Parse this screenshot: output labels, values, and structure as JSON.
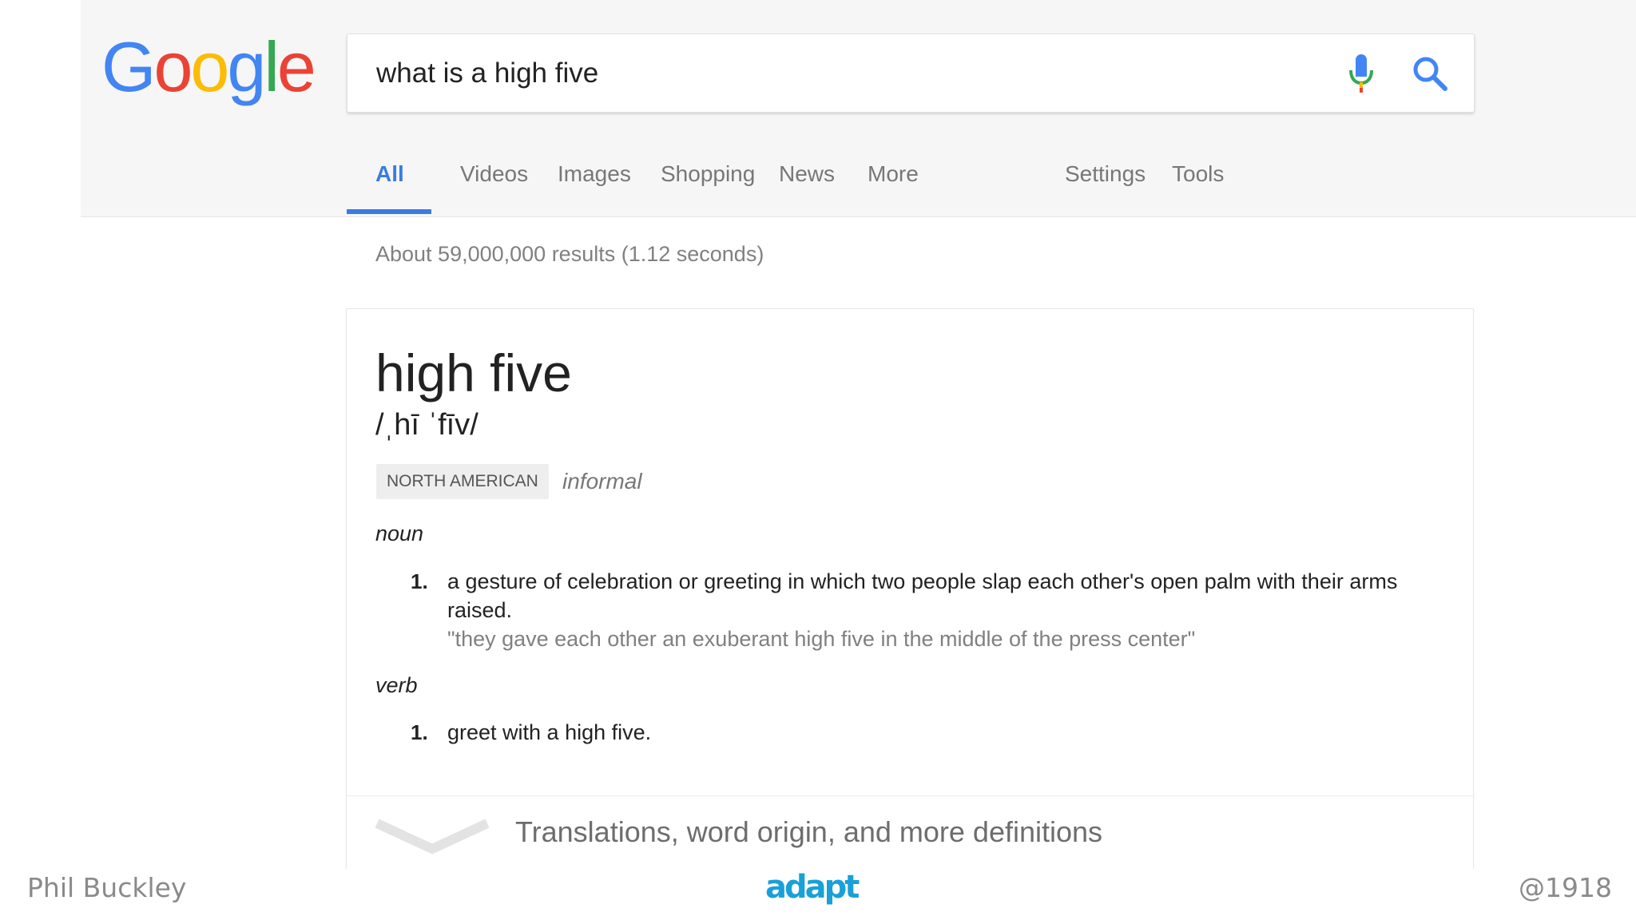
{
  "logo": {
    "letters": [
      "G",
      "o",
      "o",
      "g",
      "l",
      "e"
    ],
    "colors": [
      "#4285f4",
      "#ea4335",
      "#fbbc05",
      "#4285f4",
      "#34a853",
      "#ea4335"
    ]
  },
  "search": {
    "query": "what is a high five",
    "mic_icon": "mic-icon",
    "search_icon": "search-icon"
  },
  "tabs": [
    {
      "label": "All",
      "active": true
    },
    {
      "label": "Videos",
      "active": false
    },
    {
      "label": "Images",
      "active": false
    },
    {
      "label": "Shopping",
      "active": false
    },
    {
      "label": "News",
      "active": false
    },
    {
      "label": "More",
      "active": false
    },
    {
      "label": "Settings",
      "active": false
    },
    {
      "label": "Tools",
      "active": false
    }
  ],
  "result_stats": "About 59,000,000 results (1.12 seconds)",
  "dictionary": {
    "word": "high five",
    "pronunciation": "/ˌhī ˈfīv/",
    "region": "NORTH AMERICAN",
    "register": "informal",
    "noun": {
      "label": "noun",
      "definitions": [
        {
          "number": "1.",
          "text": "a gesture of celebration or greeting in which two people slap each other's open palm with their arms raised.",
          "example": "\"they gave each other an exuberant high five in the middle of the press center\""
        }
      ]
    },
    "verb": {
      "label": "verb",
      "definitions": [
        {
          "number": "1.",
          "text": "greet with a high five."
        }
      ]
    },
    "more_link": "Translations, word origin, and more definitions"
  },
  "footer": {
    "author": "Phil Buckley",
    "handle": "@1918",
    "brand": "adapt"
  },
  "colors": {
    "accent_blue": "#3a7ce0",
    "header_bg": "#f6f6f6",
    "muted_text": "#808080",
    "brand_dark": "#111111",
    "brand_blue": "#1aa0d8"
  }
}
